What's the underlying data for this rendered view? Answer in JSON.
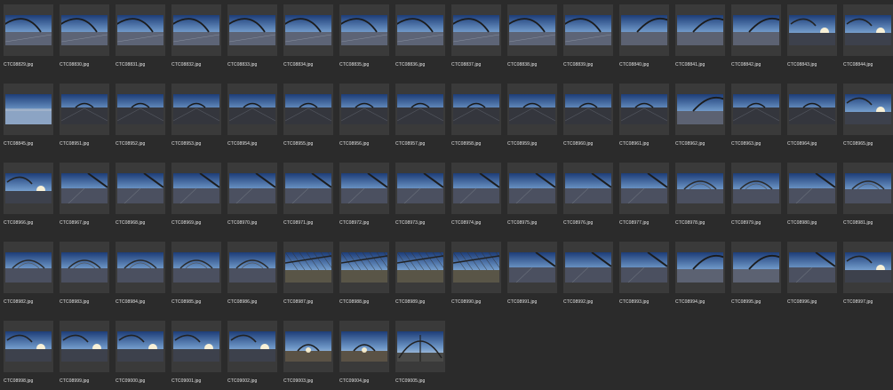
{
  "grid": {
    "files": [
      {
        "name": "CTC08829.jpg",
        "scene": "arch-left"
      },
      {
        "name": "CTC08830.jpg",
        "scene": "arch-left"
      },
      {
        "name": "CTC08831.jpg",
        "scene": "arch-left"
      },
      {
        "name": "CTC08832.jpg",
        "scene": "arch-left"
      },
      {
        "name": "CTC08833.jpg",
        "scene": "arch-left"
      },
      {
        "name": "CTC08834.jpg",
        "scene": "arch-left"
      },
      {
        "name": "CTC08835.jpg",
        "scene": "arch-left"
      },
      {
        "name": "CTC08836.jpg",
        "scene": "arch-left"
      },
      {
        "name": "CTC08837.jpg",
        "scene": "arch-left"
      },
      {
        "name": "CTC08838.jpg",
        "scene": "arch-left"
      },
      {
        "name": "CTC08839.jpg",
        "scene": "arch-left"
      },
      {
        "name": "CTC08840.jpg",
        "scene": "arch-right"
      },
      {
        "name": "CTC08841.jpg",
        "scene": "arch-right"
      },
      {
        "name": "CTC08842.jpg",
        "scene": "arch-right"
      },
      {
        "name": "CTC08843.jpg",
        "scene": "sunrise"
      },
      {
        "name": "CTC08844.jpg",
        "scene": "sunrise"
      },
      {
        "name": "CTC08845.jpg",
        "scene": "walkway"
      },
      {
        "name": "CTC08951.jpg",
        "scene": "dusk-deck"
      },
      {
        "name": "CTC08952.jpg",
        "scene": "dusk-deck"
      },
      {
        "name": "CTC08953.jpg",
        "scene": "dusk-deck"
      },
      {
        "name": "CTC08954.jpg",
        "scene": "dusk-deck"
      },
      {
        "name": "CTC08955.jpg",
        "scene": "dusk-deck"
      },
      {
        "name": "CTC08956.jpg",
        "scene": "dusk-deck"
      },
      {
        "name": "CTC08957.jpg",
        "scene": "dusk-deck"
      },
      {
        "name": "CTC08958.jpg",
        "scene": "dusk-deck"
      },
      {
        "name": "CTC08959.jpg",
        "scene": "dusk-deck"
      },
      {
        "name": "CTC08960.jpg",
        "scene": "dusk-deck"
      },
      {
        "name": "CTC08961.jpg",
        "scene": "dusk-deck"
      },
      {
        "name": "CTC08962.jpg",
        "scene": "arch-right"
      },
      {
        "name": "CTC08963.jpg",
        "scene": "dusk-deck"
      },
      {
        "name": "CTC08964.jpg",
        "scene": "dusk-deck"
      },
      {
        "name": "CTC08965.jpg",
        "scene": "sunrise"
      },
      {
        "name": "CTC08966.jpg",
        "scene": "sunrise"
      },
      {
        "name": "CTC08967.jpg",
        "scene": "deck-blue"
      },
      {
        "name": "CTC08968.jpg",
        "scene": "deck-blue"
      },
      {
        "name": "CTC08969.jpg",
        "scene": "deck-blue"
      },
      {
        "name": "CTC08970.jpg",
        "scene": "deck-blue"
      },
      {
        "name": "CTC08971.jpg",
        "scene": "deck-blue"
      },
      {
        "name": "CTC08972.jpg",
        "scene": "deck-blue"
      },
      {
        "name": "CTC08973.jpg",
        "scene": "deck-blue"
      },
      {
        "name": "CTC08974.jpg",
        "scene": "deck-blue"
      },
      {
        "name": "CTC08975.jpg",
        "scene": "deck-blue"
      },
      {
        "name": "CTC08976.jpg",
        "scene": "deck-blue"
      },
      {
        "name": "CTC08977.jpg",
        "scene": "deck-blue"
      },
      {
        "name": "CTC08978.jpg",
        "scene": "arch-center"
      },
      {
        "name": "CTC08979.jpg",
        "scene": "arch-center"
      },
      {
        "name": "CTC08980.jpg",
        "scene": "deck-blue"
      },
      {
        "name": "CTC08981.jpg",
        "scene": "arch-center"
      },
      {
        "name": "CTC08982.jpg",
        "scene": "arch-center"
      },
      {
        "name": "CTC08983.jpg",
        "scene": "arch-center"
      },
      {
        "name": "CTC08984.jpg",
        "scene": "arch-center"
      },
      {
        "name": "CTC08985.jpg",
        "scene": "arch-center"
      },
      {
        "name": "CTC08986.jpg",
        "scene": "arch-center"
      },
      {
        "name": "CTC08987.jpg",
        "scene": "cables"
      },
      {
        "name": "CTC08988.jpg",
        "scene": "cables"
      },
      {
        "name": "CTC08989.jpg",
        "scene": "cables"
      },
      {
        "name": "CTC08990.jpg",
        "scene": "cables"
      },
      {
        "name": "CTC08991.jpg",
        "scene": "deck-blue"
      },
      {
        "name": "CTC08992.jpg",
        "scene": "deck-blue"
      },
      {
        "name": "CTC08993.jpg",
        "scene": "deck-blue"
      },
      {
        "name": "CTC08994.jpg",
        "scene": "arch-right"
      },
      {
        "name": "CTC08995.jpg",
        "scene": "arch-right"
      },
      {
        "name": "CTC08996.jpg",
        "scene": "deck-blue"
      },
      {
        "name": "CTC08997.jpg",
        "scene": "sunrise"
      },
      {
        "name": "CTC08998.jpg",
        "scene": "sunrise"
      },
      {
        "name": "CTC08999.jpg",
        "scene": "sunrise"
      },
      {
        "name": "CTC09000.jpg",
        "scene": "sunrise"
      },
      {
        "name": "CTC09001.jpg",
        "scene": "sunrise"
      },
      {
        "name": "CTC09002.jpg",
        "scene": "sunrise"
      },
      {
        "name": "CTC09003.jpg",
        "scene": "low-arch"
      },
      {
        "name": "CTC09004.jpg",
        "scene": "low-arch"
      },
      {
        "name": "CTC09005.jpg",
        "scene": "pillar"
      }
    ]
  },
  "colors": {
    "background": "#2b2b2b",
    "frame": "#3a3a3a",
    "caption": "#e4e4e4"
  }
}
